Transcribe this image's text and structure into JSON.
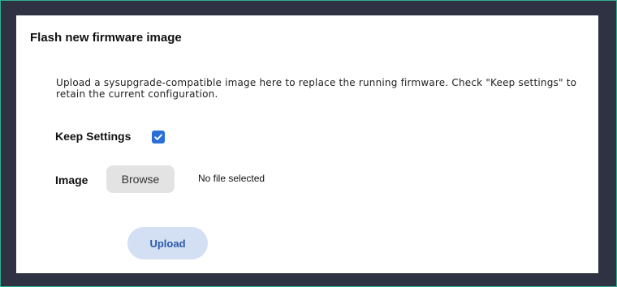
{
  "section": {
    "title": "Flash new firmware image",
    "description": "Upload a sysupgrade-compatible image here to replace the running firmware. Check \"Keep settings\" to retain the current configuration."
  },
  "keep_settings": {
    "label": "Keep Settings",
    "checked": true,
    "checkbox_color": "#2a6fd6"
  },
  "image": {
    "label": "Image",
    "browse_label": "Browse",
    "file_status": "No file selected"
  },
  "actions": {
    "upload_label": "Upload"
  },
  "colors": {
    "background": "#2f3243",
    "frame_border": "#2fae8e",
    "panel": "#ffffff",
    "upload_button_bg": "#d3dff3",
    "upload_button_text": "#2a5aa8"
  }
}
